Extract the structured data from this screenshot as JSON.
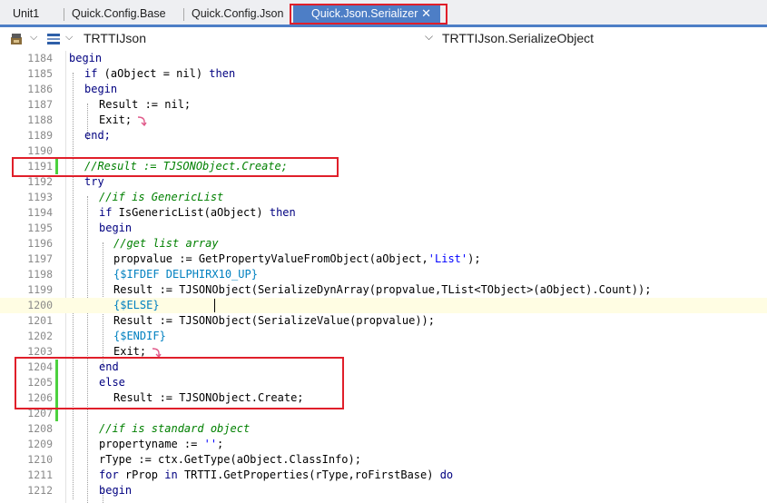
{
  "tabs": [
    {
      "label": "Unit1",
      "active": false
    },
    {
      "label": "Quick.Config.Base",
      "active": false
    },
    {
      "label": "Quick.Config.Json",
      "active": false
    },
    {
      "label": "Quick.Json.Serializer",
      "active": true
    }
  ],
  "toolbar": {
    "class_selector": "TRTTIJson",
    "method_selector": "TRTTIJson.SerializeObject",
    "icons": [
      "component-icon",
      "chevron-down-icon",
      "layout-icon",
      "chevron-down-icon"
    ]
  },
  "editor": {
    "lines": [
      {
        "n": "1184"
      },
      {
        "n": "1185"
      },
      {
        "n": "1186"
      },
      {
        "n": "1187"
      },
      {
        "n": "1188"
      },
      {
        "n": "1189"
      },
      {
        "n": "1190"
      },
      {
        "n": "1191"
      },
      {
        "n": "1192"
      },
      {
        "n": "1193"
      },
      {
        "n": "1194"
      },
      {
        "n": "1195"
      },
      {
        "n": "1196"
      },
      {
        "n": "1197"
      },
      {
        "n": "1198"
      },
      {
        "n": "1199"
      },
      {
        "n": "1200"
      },
      {
        "n": "1201"
      },
      {
        "n": "1202"
      },
      {
        "n": "1203"
      },
      {
        "n": "1204"
      },
      {
        "n": "1205"
      },
      {
        "n": "1206"
      },
      {
        "n": "1207"
      },
      {
        "n": "1208"
      },
      {
        "n": "1209"
      },
      {
        "n": "1210"
      },
      {
        "n": "1211"
      },
      {
        "n": "1212"
      }
    ],
    "code": {
      "l1184": "begin",
      "l1185a": "if",
      "l1185b": " (aObject = nil) ",
      "l1185c": "then",
      "l1186": "begin",
      "l1187": "Result := nil;",
      "l1188": "Exit;",
      "l1189": "end;",
      "l1191": "//Result := TJSONObject.Create;",
      "l1192": "try",
      "l1193": "//if is GenericList",
      "l1194a": "if",
      "l1194b": " IsGenericList(aObject) ",
      "l1194c": "then",
      "l1195": "begin",
      "l1196": "//get list array",
      "l1197a": "propvalue := GetPropertyValueFromObject(aObject,",
      "l1197b": "'List'",
      "l1197c": ");",
      "l1198": "{$IFDEF DELPHIRX10_UP}",
      "l1199": "Result := TJSONObject(SerializeDynArray(propvalue,TList<TObject>(aObject).Count));",
      "l1200": "{$ELSE}",
      "l1201": "Result := TJSONObject(SerializeValue(propvalue));",
      "l1202": "{$ENDIF}",
      "l1203": "Exit;",
      "l1204": "end",
      "l1205": "else",
      "l1206": "Result := TJSONObject.Create;",
      "l1208": "//if is standard object",
      "l1209a": "propertyname := ",
      "l1209b": "''",
      "l1209c": ";",
      "l1210": "rType := ctx.GetType(aObject.ClassInfo);",
      "l1211a": "for",
      "l1211b": " rProp ",
      "l1211c": "in",
      "l1211d": " TRTTI.GetProperties(rType,roFirstBase) ",
      "l1211e": "do",
      "l1212": "begin"
    }
  },
  "colors": {
    "accent": "#4d7ec6",
    "highlight_box": "#e01f2a",
    "modified_marker": "#4cd13e",
    "keyword": "#000080",
    "comment": "#008000",
    "string": "#0000ff",
    "directive": "#0080c0"
  }
}
